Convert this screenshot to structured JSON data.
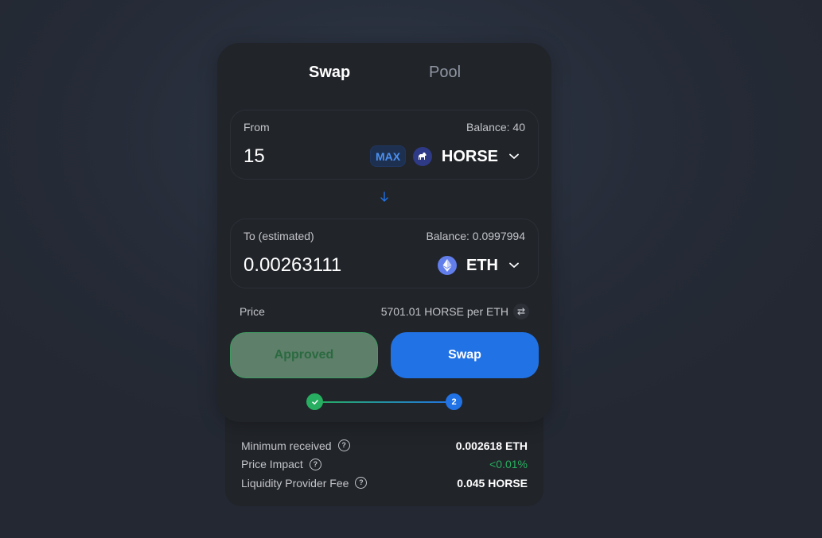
{
  "tabs": {
    "swap": "Swap",
    "pool": "Pool"
  },
  "from": {
    "label": "From",
    "balance": "Balance: 40",
    "amount": "15",
    "max_label": "MAX",
    "token_symbol": "HORSE",
    "token_icon": "horse-icon"
  },
  "to": {
    "label": "To (estimated)",
    "balance": "Balance: 0.0997994",
    "amount": "0.00263111",
    "token_symbol": "ETH",
    "token_icon": "eth-icon"
  },
  "price": {
    "label": "Price",
    "value": "5701.01 HORSE per ETH"
  },
  "buttons": {
    "approved": "Approved",
    "swap": "Swap"
  },
  "stepper": {
    "step1_state": "done",
    "step2_label": "2"
  },
  "details": {
    "minimum_received_label": "Minimum received",
    "minimum_received_value": "0.002618 ETH",
    "price_impact_label": "Price Impact",
    "price_impact_value": "<0.01%",
    "lp_fee_label": "Liquidity Provider Fee",
    "lp_fee_value": "0.045 HORSE"
  },
  "colors": {
    "accent": "#2172e5",
    "success": "#27ae60",
    "card": "#212429"
  }
}
